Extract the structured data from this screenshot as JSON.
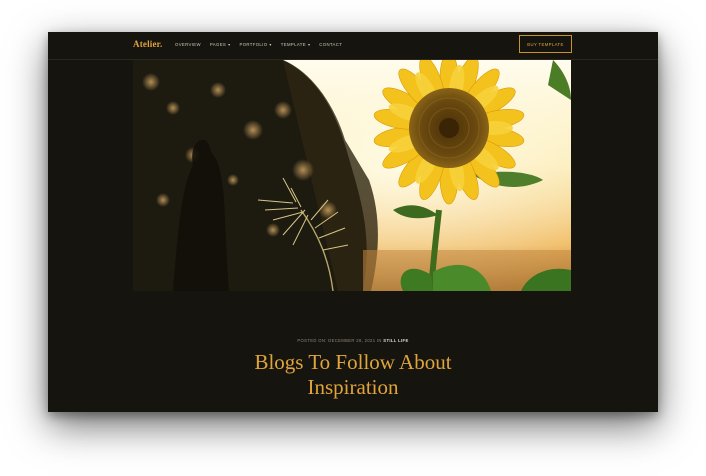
{
  "nav": {
    "logo": "Atelier.",
    "items": [
      {
        "label": "OVERVIEW",
        "has_dropdown": false
      },
      {
        "label": "PAGES",
        "has_dropdown": true
      },
      {
        "label": "PORTFOLIO",
        "has_dropdown": true
      },
      {
        "label": "TEMPLATE",
        "has_dropdown": true
      },
      {
        "label": "CONTACT",
        "has_dropdown": false
      }
    ],
    "cta": "BUY TEMPLATE"
  },
  "post": {
    "posted_on": "POSTED ON: DECEMBER 28, 2021 IN",
    "category": "STILL LIFE",
    "title": "Blogs To Follow About Inspiration"
  },
  "colors": {
    "background": "#16140f",
    "accent": "#e0a43c"
  }
}
